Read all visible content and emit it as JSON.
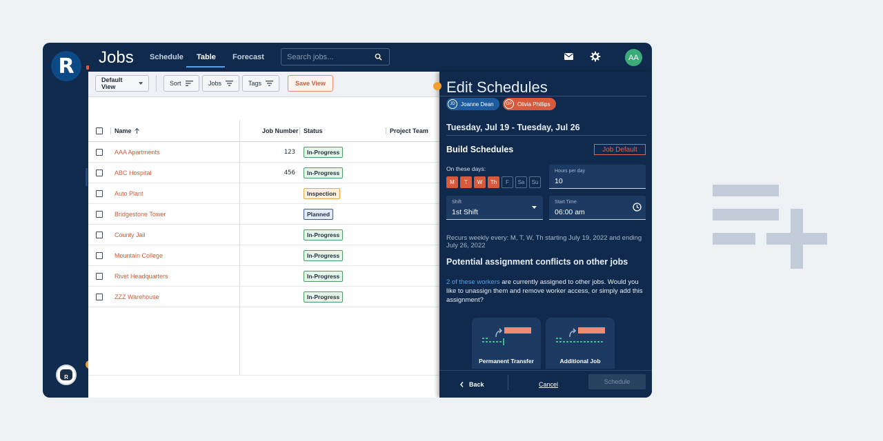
{
  "colors": {
    "navy": "#0f2a4d",
    "accent_orange": "#d85a3c",
    "link_blue": "#57a0e6",
    "in_progress_bg": "#e6f4ea",
    "in_progress_border": "#4c9a66",
    "inspection_bg": "#fdf0dc",
    "inspection_border": "#e6a64a",
    "planned_bg": "#e2ebf7",
    "planned_border": "#3d5a86"
  },
  "app": {
    "logo_letter": "R",
    "title": "Jobs",
    "tabs": [
      {
        "label": "Schedule"
      },
      {
        "label": "Table"
      },
      {
        "label": "Forecast"
      }
    ],
    "active_tab": "Table",
    "search_placeholder": "Search jobs...",
    "user_initials": "AA",
    "icons": [
      "search-icon",
      "mail-icon",
      "gear-icon",
      "robot-icon"
    ]
  },
  "toolbar": {
    "default_view": "Default View",
    "sort": "Sort",
    "jobs": "Jobs",
    "tags": "Tags",
    "save_view": "Save View"
  },
  "table": {
    "columns": {
      "name": "Name",
      "job_number": "Job Number",
      "status": "Status",
      "project_team": "Project Team"
    },
    "rows": [
      {
        "name": "AAA Apartments",
        "job_number": "123",
        "status": "In-Progress"
      },
      {
        "name": "ABC Hospital",
        "job_number": "456",
        "status": "In-Progress"
      },
      {
        "name": "Auto Plant",
        "job_number": "",
        "status": "Inspection"
      },
      {
        "name": "Bridgestone Tower",
        "job_number": "",
        "status": "Planned"
      },
      {
        "name": "County Jail",
        "job_number": "",
        "status": "In-Progress"
      },
      {
        "name": "Mountain College",
        "job_number": "",
        "status": "In-Progress"
      },
      {
        "name": "Rivet Headquarters",
        "job_number": "",
        "status": "In-Progress"
      },
      {
        "name": "ZZZ Warehouse",
        "job_number": "",
        "status": "In-Progress"
      }
    ]
  },
  "drawer": {
    "title": "Edit Schedules",
    "workers": [
      {
        "initials": "JD",
        "name": "Joanne Dean",
        "color": "#1d5b9e"
      },
      {
        "initials": "OP",
        "name": "Olivia Phillips",
        "color": "#d85a3c"
      }
    ],
    "date_range": "Tuesday, Jul 19 - Tuesday, Jul 26",
    "build_title": "Build Schedules",
    "job_default": "Job Default",
    "days_label": "On these days:",
    "days": [
      {
        "label": "M",
        "on": true
      },
      {
        "label": "T",
        "on": true
      },
      {
        "label": "W",
        "on": true
      },
      {
        "label": "Th",
        "on": true
      },
      {
        "label": "F",
        "on": false
      },
      {
        "label": "Sa",
        "on": false
      },
      {
        "label": "Su",
        "on": false
      }
    ],
    "hours_label": "Hours per day",
    "hours_value": "10",
    "shift_label": "Shift",
    "shift_value": "1st Shift",
    "start_label": "Start Time",
    "start_value": "06:00 am",
    "recurs_text": "Recurs weekly every: M, T, W, Th starting July 19, 2022 and ending July 26, 2022",
    "conflict_title": "Potential assignment conflicts on other jobs",
    "conflict_link": "2 of these workers",
    "conflict_text": " are currently assigned to other jobs. Would you like to unassign them and remove worker access, or simply add this assignment?",
    "options": [
      {
        "label": "Permanent Transfer"
      },
      {
        "label": "Additional Job"
      }
    ],
    "back": "Back",
    "cancel": "Cancel",
    "schedule": "Schedule"
  }
}
